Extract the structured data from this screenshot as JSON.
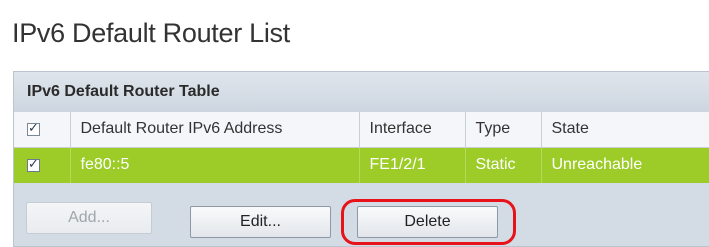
{
  "page": {
    "title": "IPv6 Default Router List"
  },
  "table": {
    "title": "IPv6 Default Router Table",
    "columns": {
      "address": "Default Router IPv6 Address",
      "interface": "Interface",
      "type": "Type",
      "state": "State"
    },
    "header_checkbox_checked": true,
    "rows": [
      {
        "selected": true,
        "address": "fe80::5",
        "interface": "FE1/2/1",
        "type": "Static",
        "state": "Unreachable"
      }
    ]
  },
  "buttons": {
    "add_label": "Add...",
    "add_enabled": false,
    "edit_label": "Edit...",
    "delete_label": "Delete"
  },
  "colors": {
    "selected_row": "#9dcc29",
    "highlight_ring": "#e8131a"
  }
}
